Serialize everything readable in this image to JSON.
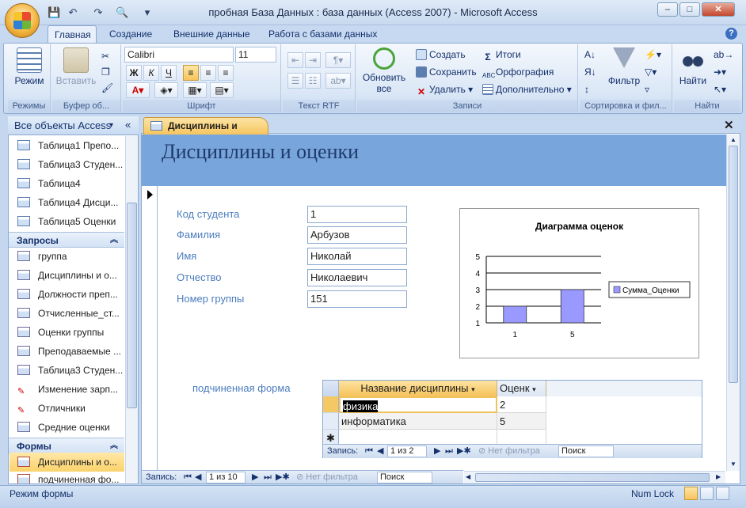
{
  "window": {
    "title": "пробная База Данных : база данных (Access 2007)  -  Microsoft Access",
    "minimize": "–",
    "maximize": "□",
    "close": "✕"
  },
  "ribbon_tabs": [
    "Главная",
    "Создание",
    "Внешние данные",
    "Работа с базами данных"
  ],
  "ribbon": {
    "views": {
      "mode_label": "Режим",
      "group": "Режимы"
    },
    "clipboard": {
      "paste_label": "Вставить",
      "group": "Буфер об..."
    },
    "font": {
      "font_name": "Calibri",
      "font_size": "11",
      "group": "Шрифт"
    },
    "rtf": {
      "group": "Текст RTF"
    },
    "records": {
      "refresh_label": "Обновить",
      "refresh_sub": "все",
      "create": "Создать",
      "save": "Сохранить",
      "delete": "Удалить",
      "totals": "Итоги",
      "spelling": "Орфография",
      "more": "Дополнительно",
      "group": "Записи"
    },
    "sort": {
      "filter_label": "Фильтр",
      "group": "Сортировка и фил..."
    },
    "find": {
      "find_label": "Найти",
      "group": "Найти"
    }
  },
  "nav": {
    "title": "Все объекты Access",
    "tables": [
      "Таблица1 Препо...",
      "Таблица3 Студен...",
      "Таблица4",
      "Таблица4 Дисци...",
      "Таблица5 Оценки"
    ],
    "queries_header": "Запросы",
    "queries": [
      "группа",
      "Дисциплины и о...",
      "Должности преп...",
      "Отчисленные_ст...",
      "Оценки группы",
      "Преподаваемые ...",
      "Таблица3 Студен...",
      "Изменение зарп...",
      "Отличники",
      "Средние оценки"
    ],
    "forms_header": "Формы",
    "forms": [
      "Дисциплины и о...",
      "подчиненная фо..."
    ]
  },
  "document": {
    "tab_title": "Дисциплины и оценки",
    "form_title": "Дисциплины и оценки",
    "fields": [
      {
        "label": "Код студента",
        "value": "1"
      },
      {
        "label": "Фамилия",
        "value": "Арбузов"
      },
      {
        "label": "Имя",
        "value": "Николай"
      },
      {
        "label": "Отчество",
        "value": "Николаевич"
      },
      {
        "label": "Номер группы",
        "value": "151"
      }
    ],
    "subform_label": "подчиненная форма",
    "subform": {
      "columns": [
        "Название дисциплины",
        "Оценк"
      ],
      "rows": [
        {
          "name": "физика",
          "grade": "2"
        },
        {
          "name": "информатика",
          "grade": "5"
        }
      ],
      "new_row_marker": "✱",
      "nav": {
        "label": "Запись:",
        "position": "1 из 2",
        "filter": "Нет фильтра",
        "search": "Поиск"
      }
    },
    "main_nav": {
      "label": "Запись:",
      "position": "1 из 10",
      "filter": "Нет фильтра",
      "search": "Поиск"
    }
  },
  "chart_data": {
    "type": "bar",
    "title": "Диаграмма оценок",
    "categories": [
      "1",
      "5"
    ],
    "series": [
      {
        "name": "Сумма_Оценки",
        "values": [
          2,
          3
        ],
        "color": "#9999ff"
      }
    ],
    "ylim": [
      1,
      5
    ],
    "yticks": [
      "1",
      "2",
      "3",
      "4",
      "5"
    ],
    "grid": true,
    "legend": "right"
  },
  "status": {
    "left": "Режим формы",
    "num_lock": "Num Lock"
  }
}
